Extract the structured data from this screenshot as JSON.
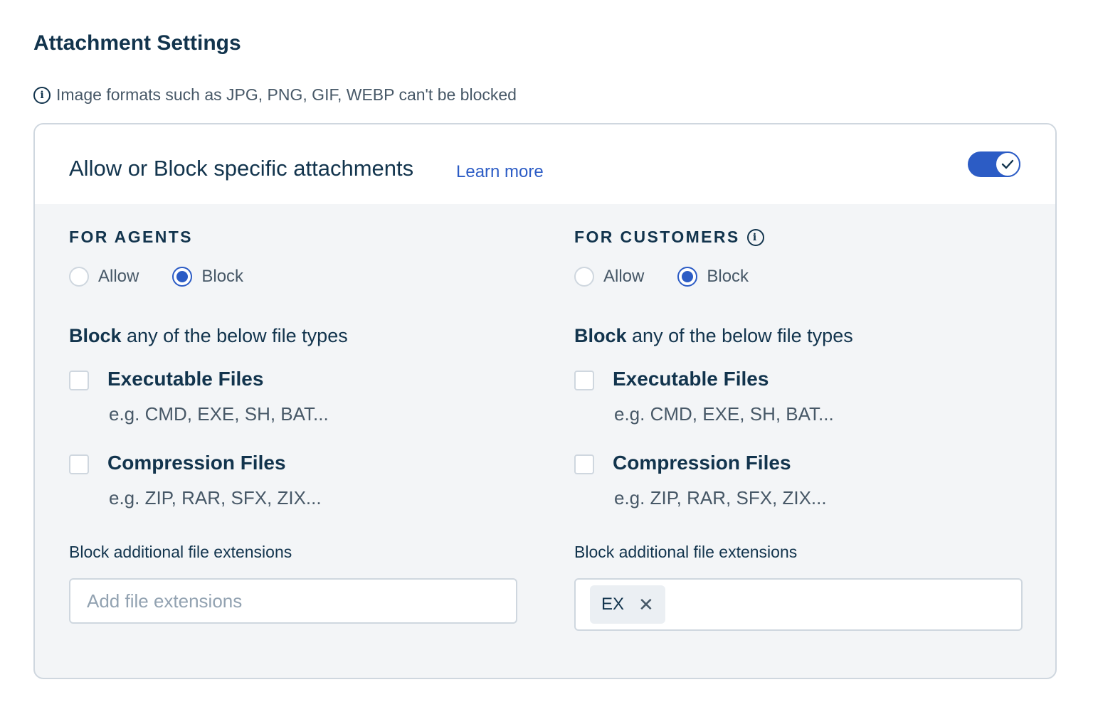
{
  "page": {
    "title": "Attachment Settings",
    "info_note": "Image formats such as JPG, PNG, GIF, WEBP can't be blocked"
  },
  "card": {
    "title": "Allow or Block specific attachments",
    "learn_more": "Learn more",
    "toggle_enabled": true
  },
  "agents": {
    "label": "FOR AGENTS",
    "radio_allow": "Allow",
    "radio_block": "Block",
    "selected": "Block",
    "heading_bold": "Block",
    "heading_rest": " any of the below file types",
    "executable_title": "Executable Files",
    "executable_desc": "e.g. CMD, EXE, SH, BAT...",
    "compression_title": "Compression Files",
    "compression_desc": "e.g. ZIP, RAR, SFX, ZIX...",
    "ext_label": "Block additional file extensions",
    "ext_placeholder": "Add file extensions"
  },
  "customers": {
    "label": "FOR CUSTOMERS",
    "radio_allow": "Allow",
    "radio_block": "Block",
    "selected": "Block",
    "heading_bold": "Block",
    "heading_rest": " any of the below file types",
    "executable_title": "Executable Files",
    "executable_desc": "e.g. CMD, EXE, SH, BAT...",
    "compression_title": "Compression Files",
    "compression_desc": "e.g. ZIP, RAR, SFX, ZIX...",
    "ext_label": "Block additional file extensions",
    "tags": [
      "EX"
    ]
  },
  "colors": {
    "accent": "#2c5cc5",
    "text_primary": "#12344d",
    "text_secondary": "#475867",
    "border": "#cfd7df",
    "panel_bg": "#f3f5f7"
  },
  "icons": {
    "info": "info-icon",
    "toggle_check": "check-icon",
    "tag_remove": "close-icon"
  }
}
